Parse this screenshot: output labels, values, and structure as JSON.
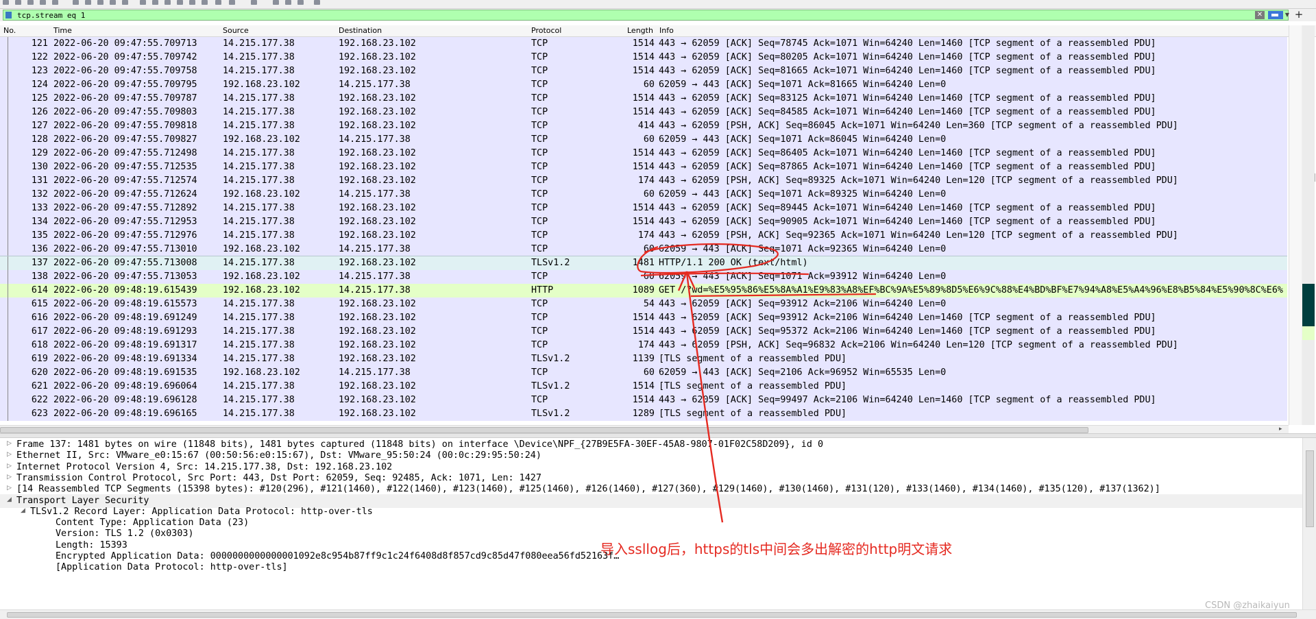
{
  "filter": {
    "value": "tcp.stream eq 1",
    "clear_glyph": "✕",
    "add_glyph": "+"
  },
  "columns": {
    "no": "No.",
    "time": "Time",
    "source": "Source",
    "destination": "Destination",
    "protocol": "Protocol",
    "length": "Length",
    "info": "Info"
  },
  "packets": [
    {
      "no": "121",
      "time": "2022-06-20 09:47:55.709713",
      "src": "14.215.177.38",
      "dst": "192.168.23.102",
      "proto": "TCP",
      "len": "1514",
      "info": "443 → 62059 [ACK] Seq=78745 Ack=1071 Win=64240 Len=1460 [TCP segment of a reassembled PDU]"
    },
    {
      "no": "122",
      "time": "2022-06-20 09:47:55.709742",
      "src": "14.215.177.38",
      "dst": "192.168.23.102",
      "proto": "TCP",
      "len": "1514",
      "info": "443 → 62059 [ACK] Seq=80205 Ack=1071 Win=64240 Len=1460 [TCP segment of a reassembled PDU]"
    },
    {
      "no": "123",
      "time": "2022-06-20 09:47:55.709758",
      "src": "14.215.177.38",
      "dst": "192.168.23.102",
      "proto": "TCP",
      "len": "1514",
      "info": "443 → 62059 [ACK] Seq=81665 Ack=1071 Win=64240 Len=1460 [TCP segment of a reassembled PDU]"
    },
    {
      "no": "124",
      "time": "2022-06-20 09:47:55.709795",
      "src": "192.168.23.102",
      "dst": "14.215.177.38",
      "proto": "TCP",
      "len": "60",
      "info": "62059 → 443 [ACK] Seq=1071 Ack=81665 Win=64240 Len=0"
    },
    {
      "no": "125",
      "time": "2022-06-20 09:47:55.709787",
      "src": "14.215.177.38",
      "dst": "192.168.23.102",
      "proto": "TCP",
      "len": "1514",
      "info": "443 → 62059 [ACK] Seq=83125 Ack=1071 Win=64240 Len=1460 [TCP segment of a reassembled PDU]"
    },
    {
      "no": "126",
      "time": "2022-06-20 09:47:55.709803",
      "src": "14.215.177.38",
      "dst": "192.168.23.102",
      "proto": "TCP",
      "len": "1514",
      "info": "443 → 62059 [ACK] Seq=84585 Ack=1071 Win=64240 Len=1460 [TCP segment of a reassembled PDU]"
    },
    {
      "no": "127",
      "time": "2022-06-20 09:47:55.709818",
      "src": "14.215.177.38",
      "dst": "192.168.23.102",
      "proto": "TCP",
      "len": "414",
      "info": "443 → 62059 [PSH, ACK] Seq=86045 Ack=1071 Win=64240 Len=360 [TCP segment of a reassembled PDU]"
    },
    {
      "no": "128",
      "time": "2022-06-20 09:47:55.709827",
      "src": "192.168.23.102",
      "dst": "14.215.177.38",
      "proto": "TCP",
      "len": "60",
      "info": "62059 → 443 [ACK] Seq=1071 Ack=86045 Win=64240 Len=0"
    },
    {
      "no": "129",
      "time": "2022-06-20 09:47:55.712498",
      "src": "14.215.177.38",
      "dst": "192.168.23.102",
      "proto": "TCP",
      "len": "1514",
      "info": "443 → 62059 [ACK] Seq=86405 Ack=1071 Win=64240 Len=1460 [TCP segment of a reassembled PDU]"
    },
    {
      "no": "130",
      "time": "2022-06-20 09:47:55.712535",
      "src": "14.215.177.38",
      "dst": "192.168.23.102",
      "proto": "TCP",
      "len": "1514",
      "info": "443 → 62059 [ACK] Seq=87865 Ack=1071 Win=64240 Len=1460 [TCP segment of a reassembled PDU]"
    },
    {
      "no": "131",
      "time": "2022-06-20 09:47:55.712574",
      "src": "14.215.177.38",
      "dst": "192.168.23.102",
      "proto": "TCP",
      "len": "174",
      "info": "443 → 62059 [PSH, ACK] Seq=89325 Ack=1071 Win=64240 Len=120 [TCP segment of a reassembled PDU]"
    },
    {
      "no": "132",
      "time": "2022-06-20 09:47:55.712624",
      "src": "192.168.23.102",
      "dst": "14.215.177.38",
      "proto": "TCP",
      "len": "60",
      "info": "62059 → 443 [ACK] Seq=1071 Ack=89325 Win=64240 Len=0"
    },
    {
      "no": "133",
      "time": "2022-06-20 09:47:55.712892",
      "src": "14.215.177.38",
      "dst": "192.168.23.102",
      "proto": "TCP",
      "len": "1514",
      "info": "443 → 62059 [ACK] Seq=89445 Ack=1071 Win=64240 Len=1460 [TCP segment of a reassembled PDU]"
    },
    {
      "no": "134",
      "time": "2022-06-20 09:47:55.712953",
      "src": "14.215.177.38",
      "dst": "192.168.23.102",
      "proto": "TCP",
      "len": "1514",
      "info": "443 → 62059 [ACK] Seq=90905 Ack=1071 Win=64240 Len=1460 [TCP segment of a reassembled PDU]"
    },
    {
      "no": "135",
      "time": "2022-06-20 09:47:55.712976",
      "src": "14.215.177.38",
      "dst": "192.168.23.102",
      "proto": "TCP",
      "len": "174",
      "info": "443 → 62059 [PSH, ACK] Seq=92365 Ack=1071 Win=64240 Len=120 [TCP segment of a reassembled PDU]"
    },
    {
      "no": "136",
      "time": "2022-06-20 09:47:55.713010",
      "src": "192.168.23.102",
      "dst": "14.215.177.38",
      "proto": "TCP",
      "len": "60",
      "info": "62059 → 443 [ACK] Seq=1071 Ack=92365 Win=64240 Len=0"
    },
    {
      "no": "137",
      "time": "2022-06-20 09:47:55.713008",
      "src": "14.215.177.38",
      "dst": "192.168.23.102",
      "proto": "TLSv1.2",
      "len": "1481",
      "info": "HTTP/1.1 200 OK  (text/html)"
    },
    {
      "no": "138",
      "time": "2022-06-20 09:47:55.713053",
      "src": "192.168.23.102",
      "dst": "14.215.177.38",
      "proto": "TCP",
      "len": "60",
      "info": "62059 → 443 [ACK] Seq=1071 Ack=93912 Win=64240 Len=0"
    },
    {
      "no": "614",
      "time": "2022-06-20 09:48:19.615439",
      "src": "192.168.23.102",
      "dst": "14.215.177.38",
      "proto": "HTTP",
      "len": "1089",
      "info": "GET /?wd=%E5%95%86%E5%8A%A1%E9%83%A8%EF%BC%9A%E5%89%8D5%E6%9C%88%E4%BD%BF%E7%94%A8%E5%A4%96%E8%B5%84%E5%90%8C%E6%"
    },
    {
      "no": "615",
      "time": "2022-06-20 09:48:19.615573",
      "src": "14.215.177.38",
      "dst": "192.168.23.102",
      "proto": "TCP",
      "len": "54",
      "info": "443 → 62059 [ACK] Seq=93912 Ack=2106 Win=64240 Len=0"
    },
    {
      "no": "616",
      "time": "2022-06-20 09:48:19.691249",
      "src": "14.215.177.38",
      "dst": "192.168.23.102",
      "proto": "TCP",
      "len": "1514",
      "info": "443 → 62059 [ACK] Seq=93912 Ack=2106 Win=64240 Len=1460 [TCP segment of a reassembled PDU]"
    },
    {
      "no": "617",
      "time": "2022-06-20 09:48:19.691293",
      "src": "14.215.177.38",
      "dst": "192.168.23.102",
      "proto": "TCP",
      "len": "1514",
      "info": "443 → 62059 [ACK] Seq=95372 Ack=2106 Win=64240 Len=1460 [TCP segment of a reassembled PDU]"
    },
    {
      "no": "618",
      "time": "2022-06-20 09:48:19.691317",
      "src": "14.215.177.38",
      "dst": "192.168.23.102",
      "proto": "TCP",
      "len": "174",
      "info": "443 → 62059 [PSH, ACK] Seq=96832 Ack=2106 Win=64240 Len=120 [TCP segment of a reassembled PDU]"
    },
    {
      "no": "619",
      "time": "2022-06-20 09:48:19.691334",
      "src": "14.215.177.38",
      "dst": "192.168.23.102",
      "proto": "TLSv1.2",
      "len": "1139",
      "info": "[TLS segment of a reassembled PDU]"
    },
    {
      "no": "620",
      "time": "2022-06-20 09:48:19.691535",
      "src": "192.168.23.102",
      "dst": "14.215.177.38",
      "proto": "TCP",
      "len": "60",
      "info": "62059 → 443 [ACK] Seq=2106 Ack=96952 Win=65535 Len=0"
    },
    {
      "no": "621",
      "time": "2022-06-20 09:48:19.696064",
      "src": "14.215.177.38",
      "dst": "192.168.23.102",
      "proto": "TLSv1.2",
      "len": "1514",
      "info": "[TLS segment of a reassembled PDU]"
    },
    {
      "no": "622",
      "time": "2022-06-20 09:48:19.696128",
      "src": "14.215.177.38",
      "dst": "192.168.23.102",
      "proto": "TCP",
      "len": "1514",
      "info": "443 → 62059 [ACK] Seq=99497 Ack=2106 Win=64240 Len=1460 [TCP segment of a reassembled PDU]"
    },
    {
      "no": "623",
      "time": "2022-06-20 09:48:19.696165",
      "src": "14.215.177.38",
      "dst": "192.168.23.102",
      "proto": "TLSv1.2",
      "len": "1289",
      "info": "[TLS segment of a reassembled PDU]"
    }
  ],
  "selected_packet_no": "137",
  "http_packet_no": "614",
  "details": [
    {
      "text": "Frame 137: 1481 bytes on wire (11848 bits), 1481 bytes captured (11848 bits) on interface \\Device\\NPF_{27B9E5FA-30EF-45A8-9807-01F02C58D209}, id 0",
      "indent": 0,
      "twisty": "▷"
    },
    {
      "text": "Ethernet II, Src: VMware_e0:15:67 (00:50:56:e0:15:67), Dst: VMware_95:50:24 (00:0c:29:95:50:24)",
      "indent": 0,
      "twisty": "▷"
    },
    {
      "text": "Internet Protocol Version 4, Src: 14.215.177.38, Dst: 192.168.23.102",
      "indent": 0,
      "twisty": "▷"
    },
    {
      "text": "Transmission Control Protocol, Src Port: 443, Dst Port: 62059, Seq: 92485, Ack: 1071, Len: 1427",
      "indent": 0,
      "twisty": "▷"
    },
    {
      "text": "[14 Reassembled TCP Segments (15398 bytes): #120(296), #121(1460), #122(1460), #123(1460), #125(1460), #126(1460), #127(360), #129(1460), #130(1460), #131(120), #133(1460), #134(1460), #135(120), #137(1362)]",
      "indent": 0,
      "twisty": "▷"
    },
    {
      "text": "Transport Layer Security",
      "indent": 0,
      "twisty": "◢"
    },
    {
      "text": "TLSv1.2 Record Layer: Application Data Protocol: http-over-tls",
      "indent": 1,
      "twisty": "◢"
    },
    {
      "text": "Content Type: Application Data (23)",
      "indent": 2,
      "twisty": ""
    },
    {
      "text": "Version: TLS 1.2 (0x0303)",
      "indent": 2,
      "twisty": ""
    },
    {
      "text": "Length: 15393",
      "indent": 2,
      "twisty": ""
    },
    {
      "text": "Encrypted Application Data: 0000000000000001092e8c954b87ff9c1c24f6408d8f857cd9c85d47f080eea56fd52163f…",
      "indent": 2,
      "twisty": ""
    },
    {
      "text": "[Application Data Protocol: http-over-tls]",
      "indent": 2,
      "twisty": ""
    }
  ],
  "annotation": {
    "text": "导入ssllog后，https的tls中间会多出解密的http明文请求",
    "color": "#e52a21"
  },
  "watermark": "CSDN @zhaikaiyun",
  "colors": {
    "tcp_row": "#e7e6ff",
    "http_row": "#e4ffc7",
    "selected_row": "#e0f1f3",
    "filter_ok": "#afffaf"
  }
}
